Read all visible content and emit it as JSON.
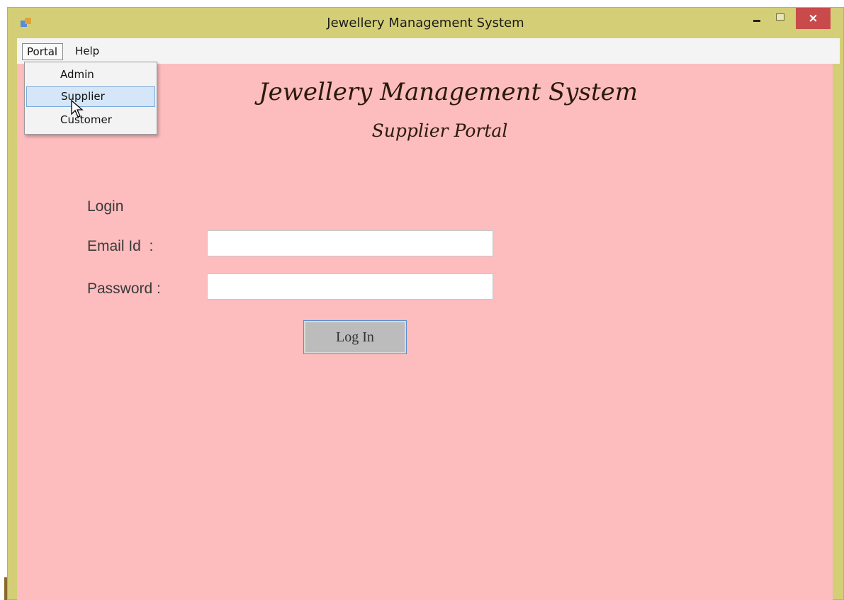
{
  "window": {
    "title": "Jewellery Management System",
    "close_glyph": "×",
    "icons": [
      "app-icon",
      "minimize-icon",
      "maximize-icon",
      "close-icon"
    ]
  },
  "menu": {
    "items": [
      "Portal",
      "Help"
    ],
    "portal_dropdown": {
      "items": [
        "Admin",
        "Supplier",
        "Customer"
      ],
      "highlighted": "Supplier"
    }
  },
  "heading": {
    "title": "Jewellery Management System",
    "subtitle": "Supplier Portal"
  },
  "form": {
    "section_label": "Login",
    "email_label": "Email Id  :",
    "email_value": "",
    "password_label": "Password :",
    "password_value": "",
    "submit_label": "Log In"
  },
  "colors": {
    "titlebar": "#d4cf76",
    "background": "#fdbcbe",
    "close_button": "#c94a4a",
    "highlight": "#d4e6f8"
  }
}
